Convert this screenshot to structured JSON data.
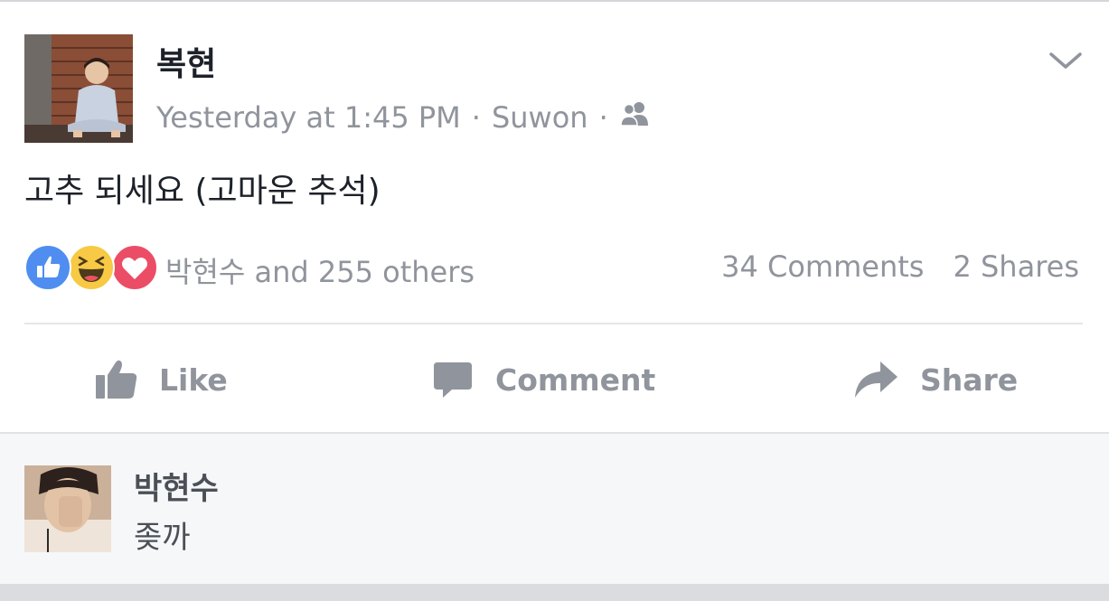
{
  "post": {
    "author": "복현",
    "time": "Yesterday at 1:45 PM",
    "separator": "·",
    "location": "Suwon",
    "audience_icon": "friends-icon",
    "text": "고추 되세요 (고마운 추석)"
  },
  "reactions": {
    "icons": [
      "like-reaction-icon",
      "haha-reaction-icon",
      "love-reaction-icon"
    ],
    "summary": "박현수 and 255 others",
    "comments": "34 Comments",
    "shares": "2 Shares"
  },
  "actions": {
    "like": "Like",
    "comment": "Comment",
    "share": "Share"
  },
  "comment": {
    "author": "박현수",
    "text": "좆까"
  },
  "colors": {
    "meta_text": "#90949c",
    "primary_text": "#1d2129",
    "like_blue": "#4f8ef0",
    "haha_yellow": "#f7c944",
    "love_red": "#ec4d66",
    "comment_bg": "#f6f7f9"
  }
}
